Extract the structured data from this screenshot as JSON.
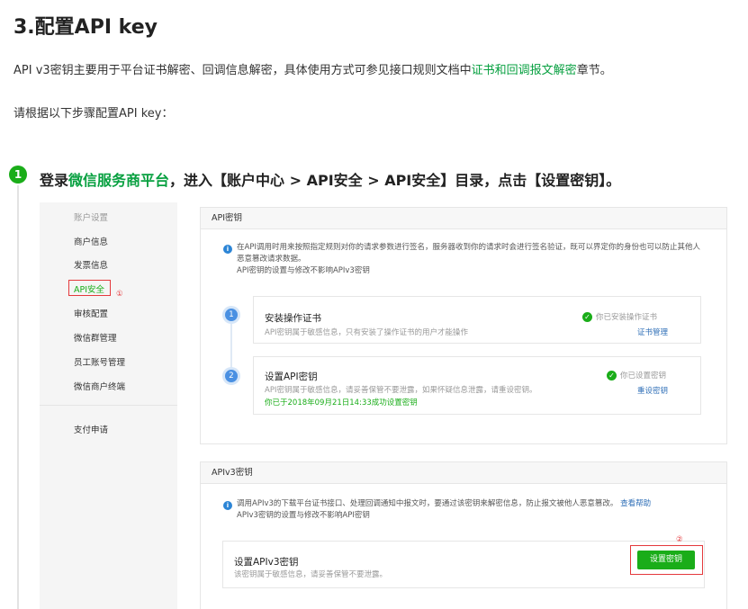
{
  "doc": {
    "title": "3.配置API key",
    "intro_before": "API v3密钥主要用于平台证书解密、回调信息解密，具体使用方式可参见接口规则文档中",
    "intro_link": "证书和回调报文解密",
    "intro_after": "章节。",
    "instruction": "请根据以下步骤配置API key："
  },
  "step": {
    "number": "1",
    "text_before": "登录",
    "link": "微信服务商平台",
    "text_after": "，进入【账户中心 > API安全 > API安全】目录，点击【设置密钥】。"
  },
  "sidebar": {
    "group_label": "账户设置",
    "items": [
      {
        "label": "商户信息"
      },
      {
        "label": "发票信息"
      },
      {
        "label": "API安全"
      },
      {
        "label": "审核配置"
      },
      {
        "label": "微信群管理"
      },
      {
        "label": "员工账号管理"
      },
      {
        "label": "微信商户终端"
      }
    ],
    "bottom_item": "支付申请",
    "marker_1": "①"
  },
  "api_key_panel": {
    "header": "API密钥",
    "note_line1": "在API调用时用来按照指定规则对你的请求参数进行签名，服务器收到你的请求时会进行签名验证，既可以界定你的身份也可以防止其他人",
    "note_line2": "恶意篡改请求数据。",
    "note_line3": "API密钥的设置与修改不影响APIv3密钥",
    "steps": [
      {
        "number": "1",
        "title": "安装操作证书",
        "desc": "API密钥属于敏感信息，只有安装了操作证书的用户才能操作",
        "status": "你已安装操作证书",
        "link": "证书管理"
      },
      {
        "number": "2",
        "title": "设置API密钥",
        "desc": "API密钥属于敏感信息，请妥善保管不要泄露，如果怀疑信息泄露，请重设密钥。",
        "green_note": "你已于2018年09月21日14:33成功设置密钥",
        "status": "你已设置密钥",
        "link": "重设密钥"
      }
    ]
  },
  "apiv3_panel": {
    "header": "APIv3密钥",
    "note_line1": "调用APIv3的下载平台证书接口、处理回调通知中报文时，要通过该密钥来解密信息，防止报文被他人恶意篡改。",
    "note_link": "查看帮助",
    "note_line2": "APIv3密钥的设置与修改不影响API密钥",
    "card_title": "设置APIv3密钥",
    "card_desc": "该密钥属于敏感信息，请妥善保管不要泄露。",
    "button_label": "设置密钥",
    "marker_2": "②"
  },
  "colors": {
    "accent_green": "#1aad19",
    "link_green": "#07a040",
    "link_blue": "#2f6fb7",
    "annotation_red": "#e4393c",
    "timeline_blue": "#4a90e2"
  }
}
